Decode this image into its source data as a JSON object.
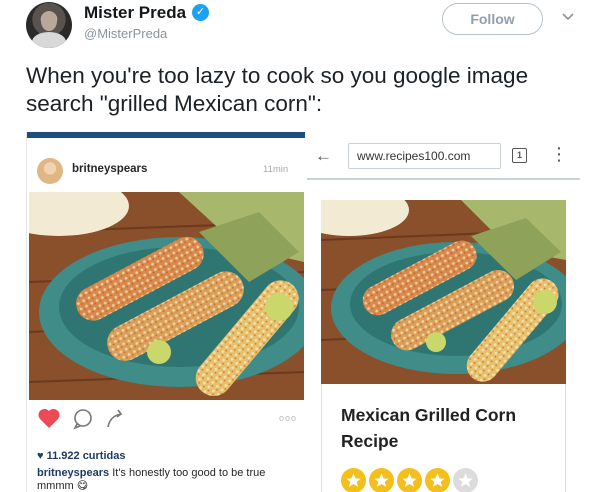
{
  "tweet": {
    "display_name": "Mister Preda",
    "handle": "@MisterPreda",
    "follow_label": "Follow",
    "text": "When you're too lazy to cook so you google image search \"grilled Mexican corn\":"
  },
  "instagram": {
    "username": "britneyspears",
    "time": "11min",
    "likes": "11.922 curtidas",
    "caption_user": "britneyspears",
    "caption_text": " It's honestly too good to be true mmmm 😋",
    "more_dots": "ooo"
  },
  "browser": {
    "url": "www.recipes100.com",
    "tab_count": "1",
    "recipe_title": "Mexican Grilled Corn Recipe",
    "rating_stars": 4,
    "rating_max": 5
  },
  "colors": {
    "verified_blue": "#1da1f2",
    "like_red": "#ed4956",
    "star_gold": "#f2bf1c"
  }
}
